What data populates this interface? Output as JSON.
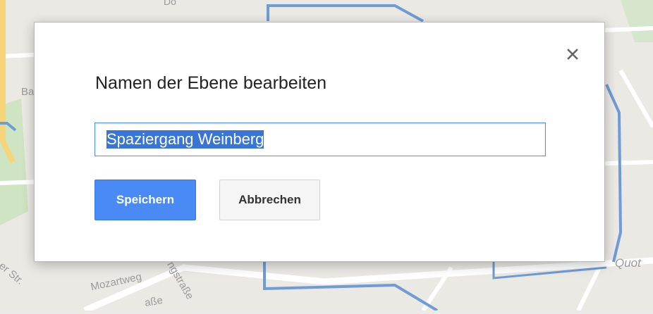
{
  "map": {
    "labels": [
      "Ba",
      "er Str.",
      "Mozartweg",
      "ngstraße",
      "aße",
      "Quot",
      "Do"
    ]
  },
  "dialog": {
    "title": "Namen der Ebene bearbeiten",
    "name_input_value": "Spaziergang Weinberg",
    "save_label": "Speichern",
    "cancel_label": "Abbrechen",
    "close_icon": "close-icon"
  },
  "colors": {
    "primary_button": "#4a8af4",
    "input_focus_border": "#4d90fe",
    "selection": "#3875d7"
  }
}
